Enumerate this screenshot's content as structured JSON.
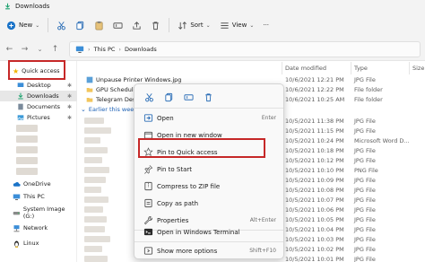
{
  "window": {
    "title": "Downloads"
  },
  "toolbar": {
    "new_label": "New",
    "sort_label": "Sort",
    "view_label": "View",
    "more_label": "···"
  },
  "address": {
    "crumbs": [
      "This PC",
      "Downloads"
    ]
  },
  "sidebar": {
    "items": [
      {
        "label": "Quick access"
      },
      {
        "label": "Desktop"
      },
      {
        "label": "Downloads"
      },
      {
        "label": "Documents"
      },
      {
        "label": "Pictures"
      },
      {
        "label": "OneDrive"
      },
      {
        "label": "This PC"
      },
      {
        "label": "System Image (G:)"
      },
      {
        "label": "Network"
      },
      {
        "label": "Linux"
      }
    ]
  },
  "columns": {
    "date": "Date modified",
    "type": "Type",
    "size": "Size"
  },
  "files": {
    "top_rows": [
      {
        "name": "Unpause Printer Windows.jpg",
        "date": "10/6/2021 12:21 PM",
        "type": "JPG File"
      },
      {
        "name": "GPU Scheduling",
        "date": "10/6/2021 12:22 PM",
        "type": "File folder"
      },
      {
        "name": "Telegram Deskt",
        "date": "10/6/2021 10:25 AM",
        "type": "File folder"
      }
    ],
    "group_label": "Earlier this wee",
    "group_rows": [
      {
        "date": "10/5/2021 11:38 PM",
        "type": "JPG File"
      },
      {
        "date": "10/5/2021 11:15 PM",
        "type": "JPG File"
      },
      {
        "date": "10/5/2021 10:24 PM",
        "type": "Microsoft Word D..."
      },
      {
        "date": "10/5/2021 10:18 PM",
        "type": "JPG File"
      },
      {
        "date": "10/5/2021 10:12 PM",
        "type": "JPG File"
      },
      {
        "date": "10/5/2021 10:10 PM",
        "type": "PNG File"
      },
      {
        "date": "10/5/2021 10:09 PM",
        "type": "JPG File"
      },
      {
        "date": "10/5/2021 10:08 PM",
        "type": "JPG File"
      },
      {
        "date": "10/5/2021 10:07 PM",
        "type": "JPG File"
      },
      {
        "date": "10/5/2021 10:06 PM",
        "type": "JPG File"
      },
      {
        "date": "10/5/2021 10:05 PM",
        "type": "JPG File"
      },
      {
        "date": "10/5/2021 10:04 PM",
        "type": "JPG File"
      },
      {
        "date": "10/5/2021 10:03 PM",
        "type": "JPG File"
      },
      {
        "date": "10/5/2021 10:02 PM",
        "type": "JPG File"
      },
      {
        "date": "10/5/2021 10:01 PM",
        "type": "JPG File"
      }
    ]
  },
  "context_menu": {
    "items": [
      {
        "label": "Open",
        "shortcut": "Enter"
      },
      {
        "label": "Open in new window",
        "shortcut": ""
      },
      {
        "label": "Pin to Quick access",
        "shortcut": ""
      },
      {
        "label": "Pin to Start",
        "shortcut": ""
      },
      {
        "label": "Compress to ZIP file",
        "shortcut": ""
      },
      {
        "label": "Copy as path",
        "shortcut": ""
      },
      {
        "label": "Properties",
        "shortcut": "Alt+Enter"
      },
      {
        "label": "Open in Windows Terminal",
        "shortcut": ""
      },
      {
        "label": "Show more options",
        "shortcut": "Shift+F10"
      }
    ]
  },
  "colors": {
    "highlight": "#c62828",
    "accent": "#1a5fb4",
    "folder": "#f2c55c"
  }
}
